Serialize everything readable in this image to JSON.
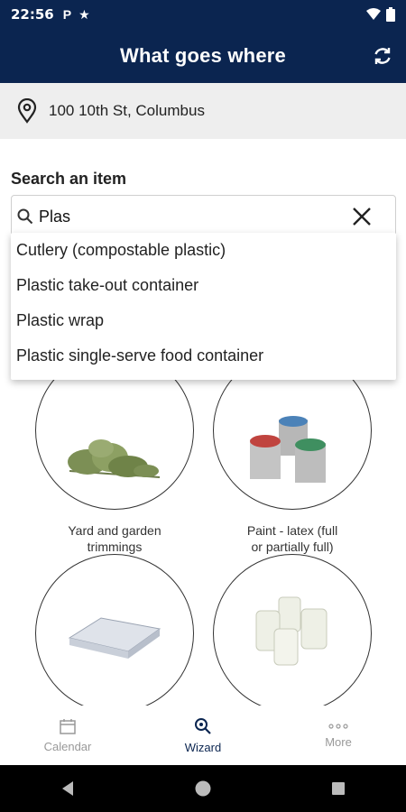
{
  "status_bar": {
    "time": "22:56",
    "p_glyph": "P",
    "icons": [
      "star-icon",
      "wifi-icon",
      "battery-icon"
    ]
  },
  "app_bar": {
    "title": "What goes where",
    "action_icon": "refresh-icon"
  },
  "location": {
    "icon": "location-pin-icon",
    "address": "100 10th St, Columbus"
  },
  "search": {
    "label": "Search an item",
    "value": "Plas",
    "placeholder": "",
    "clear_icon": "close-icon"
  },
  "suggestions": [
    "Cutlery (compostable plastic)",
    "Plastic take-out container",
    "Plastic wrap",
    "Plastic single-serve food container"
  ],
  "items": [
    {
      "line1": "Yard and garden",
      "line2": "trimmings",
      "icon": "plant-icon"
    },
    {
      "line1": "Paint - latex (full",
      "line2": "or partially full)",
      "icon": "paint-cans-icon"
    },
    {
      "line1": "",
      "line2": "",
      "icon": "mattress-icon"
    },
    {
      "line1": "",
      "line2": "",
      "icon": "glass-jars-icon"
    }
  ],
  "bottom_nav": [
    {
      "label": "Calendar",
      "icon": "calendar-icon",
      "active": false
    },
    {
      "label": "Wizard",
      "icon": "search-wizard-icon",
      "active": true
    },
    {
      "label": "More",
      "icon": "more-icon",
      "active": false
    }
  ],
  "colors": {
    "header": "#0b2550",
    "address_bg": "#eeeeee",
    "nav_inactive": "#999999",
    "nav_active": "#0b2550"
  }
}
